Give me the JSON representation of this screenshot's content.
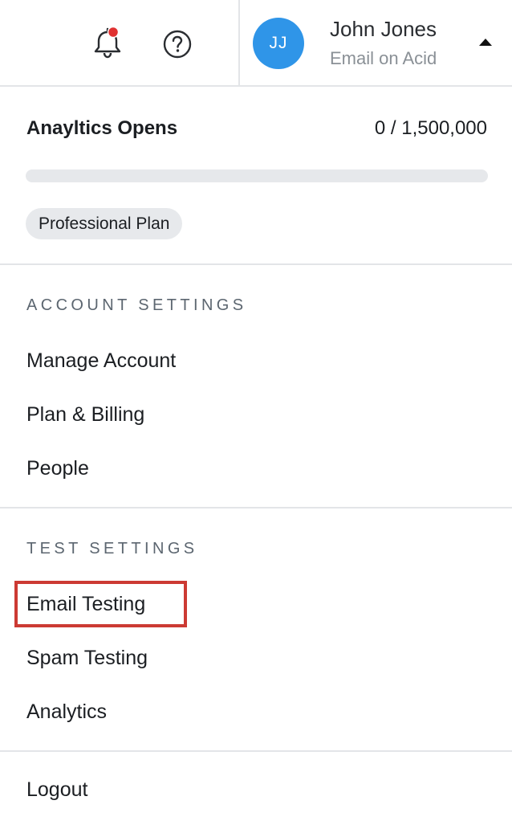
{
  "header": {
    "notification_dot_color": "#e03131",
    "bell_icon": "bell-icon",
    "help_icon": "help-icon",
    "user": {
      "initials": "JJ",
      "name": "John Jones",
      "company": "Email on Acid",
      "avatar_color": "#2f95e8"
    },
    "menu_toggle_icon": "caret-up-icon"
  },
  "usage": {
    "title": "Anayltics Opens",
    "count": "0 / 1,500,000",
    "progress_fraction": 0,
    "plan": "Professional Plan"
  },
  "sections": {
    "account": {
      "heading": "ACCOUNT SETTINGS",
      "items": [
        "Manage Account",
        "Plan & Billing",
        "People"
      ]
    },
    "test": {
      "heading": "TEST SETTINGS",
      "items": [
        "Email Testing",
        "Spam Testing",
        "Analytics"
      ]
    }
  },
  "logout_label": "Logout",
  "highlight": {
    "target": "Email Testing",
    "color": "#cc3a33"
  }
}
